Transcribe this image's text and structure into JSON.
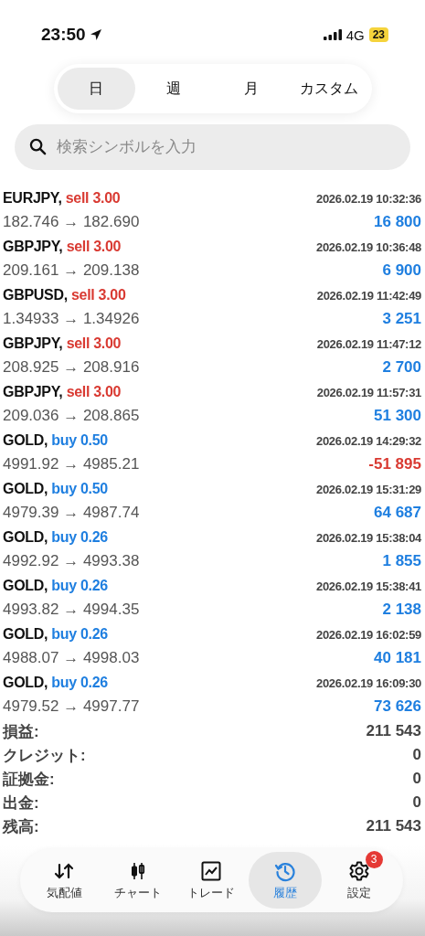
{
  "status_bar": {
    "time": "23:50",
    "network": "4G",
    "battery": "23"
  },
  "tabs": [
    {
      "label": "日",
      "selected": true
    },
    {
      "label": "週",
      "selected": false
    },
    {
      "label": "月",
      "selected": false
    },
    {
      "label": "カスタム",
      "selected": false
    }
  ],
  "search": {
    "placeholder": "検索シンボルを入力"
  },
  "trades": [
    {
      "symbol": "EURJPY,",
      "kind": "sell",
      "side": "sell 3.00",
      "time": "2026.02.19 10:32:36",
      "prices": "182.746 → 182.690",
      "profit": "16 800",
      "negative": false
    },
    {
      "symbol": "GBPJPY,",
      "kind": "sell",
      "side": "sell 3.00",
      "time": "2026.02.19 10:36:48",
      "prices": "209.161 → 209.138",
      "profit": "6 900",
      "negative": false
    },
    {
      "symbol": "GBPUSD,",
      "kind": "sell",
      "side": "sell 3.00",
      "time": "2026.02.19 11:42:49",
      "prices": "1.34933 → 1.34926",
      "profit": "3 251",
      "negative": false
    },
    {
      "symbol": "GBPJPY,",
      "kind": "sell",
      "side": "sell 3.00",
      "time": "2026.02.19 11:47:12",
      "prices": "208.925 → 208.916",
      "profit": "2 700",
      "negative": false
    },
    {
      "symbol": "GBPJPY,",
      "kind": "sell",
      "side": "sell 3.00",
      "time": "2026.02.19 11:57:31",
      "prices": "209.036 → 208.865",
      "profit": "51 300",
      "negative": false
    },
    {
      "symbol": "GOLD,",
      "kind": "buy",
      "side": "buy 0.50",
      "time": "2026.02.19 14:29:32",
      "prices": "4991.92 → 4985.21",
      "profit": "-51 895",
      "negative": true
    },
    {
      "symbol": "GOLD,",
      "kind": "buy",
      "side": "buy 0.50",
      "time": "2026.02.19 15:31:29",
      "prices": "4979.39 → 4987.74",
      "profit": "64 687",
      "negative": false
    },
    {
      "symbol": "GOLD,",
      "kind": "buy",
      "side": "buy 0.26",
      "time": "2026.02.19 15:38:04",
      "prices": "4992.92 → 4993.38",
      "profit": "1 855",
      "negative": false
    },
    {
      "symbol": "GOLD,",
      "kind": "buy",
      "side": "buy 0.26",
      "time": "2026.02.19 15:38:41",
      "prices": "4993.82 → 4994.35",
      "profit": "2 138",
      "negative": false
    },
    {
      "symbol": "GOLD,",
      "kind": "buy",
      "side": "buy 0.26",
      "time": "2026.02.19 16:02:59",
      "prices": "4988.07 → 4998.03",
      "profit": "40 181",
      "negative": false
    },
    {
      "symbol": "GOLD,",
      "kind": "buy",
      "side": "buy 0.26",
      "time": "2026.02.19 16:09:30",
      "prices": "4979.52 → 4997.77",
      "profit": "73 626",
      "negative": false
    }
  ],
  "summary": [
    {
      "label": "損益:",
      "value": "211 543"
    },
    {
      "label": "クレジット:",
      "value": "0"
    },
    {
      "label": "証拠金:",
      "value": "0"
    },
    {
      "label": "出金:",
      "value": "0"
    },
    {
      "label": "残高:",
      "value": "211 543"
    }
  ],
  "nav": [
    {
      "kind": "quotes",
      "label": "気配値",
      "selected": false
    },
    {
      "kind": "chart",
      "label": "チャート",
      "selected": false
    },
    {
      "kind": "trade",
      "label": "トレード",
      "selected": false
    },
    {
      "kind": "history",
      "label": "履歴",
      "selected": true
    },
    {
      "kind": "settings",
      "label": "設定",
      "selected": false,
      "badge": "3"
    }
  ]
}
